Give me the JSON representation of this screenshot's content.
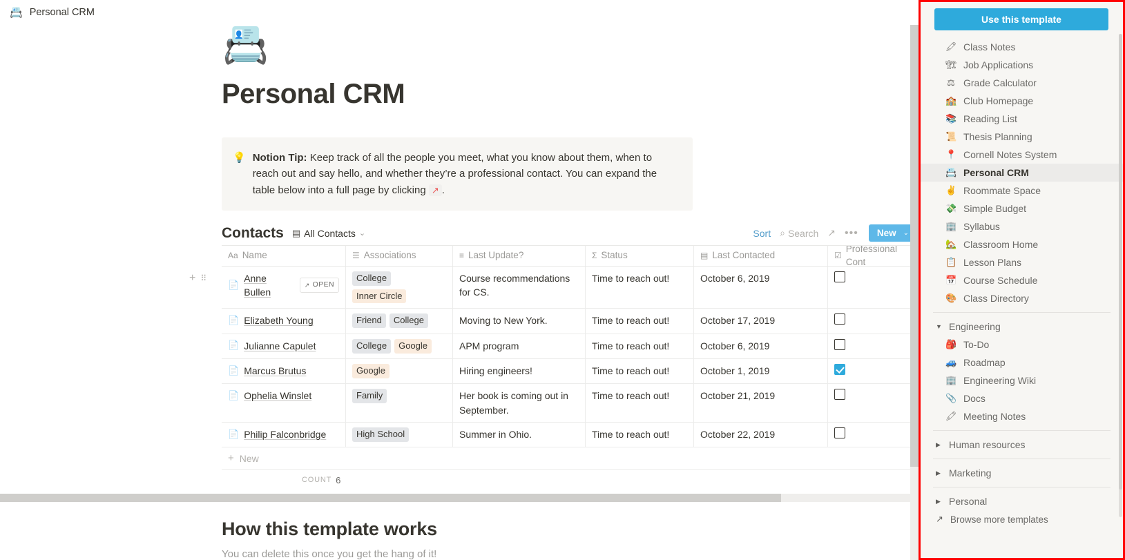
{
  "topbar": {
    "icon": "📇",
    "title": "Personal CRM"
  },
  "page": {
    "icon": "📇",
    "title": "Personal CRM",
    "callout": {
      "icon": "💡",
      "lead": "Notion Tip:",
      "text": " Keep track of all the people you meet, what you know about them, when to reach out and say hello, and whether they’re a professional contact. You can expand the table below into a full page by clicking ",
      "code": "↗",
      "tail": "."
    }
  },
  "database": {
    "title": "Contacts",
    "view_name": "All Contacts",
    "view_icon": "▤",
    "chevron": "⌄",
    "tools": {
      "sort": "Sort",
      "search": "Search",
      "search_icon": "⌕",
      "expand_icon": "↗",
      "more_icon": "•••",
      "new_label": "New",
      "new_chevron": "⌄"
    },
    "columns": [
      {
        "label": "Name",
        "icon": "Aa"
      },
      {
        "label": "Associations",
        "icon": "☰"
      },
      {
        "label": "Last Update?",
        "icon": "≡"
      },
      {
        "label": "Status",
        "icon": "Σ"
      },
      {
        "label": "Last Contacted",
        "icon": "▤"
      },
      {
        "label": "Professional Cont",
        "icon": "☑"
      }
    ],
    "rows": [
      {
        "name": "Anne Bullen",
        "open_label": "OPEN",
        "open_icon": "↗",
        "tags": [
          {
            "text": "College",
            "style": "gray"
          },
          {
            "text": "Inner Circle",
            "style": "orange"
          }
        ],
        "last_update": "Course recommendations for CS.",
        "status": "Time to reach out!",
        "last_contacted": "October 6, 2019",
        "professional": false
      },
      {
        "name": "Elizabeth Young",
        "tags": [
          {
            "text": "Friend",
            "style": "gray"
          },
          {
            "text": "College",
            "style": "gray"
          }
        ],
        "last_update": "Moving to New York.",
        "status": "Time to reach out!",
        "last_contacted": "October 17, 2019",
        "professional": false
      },
      {
        "name": "Julianne Capulet",
        "tags": [
          {
            "text": "College",
            "style": "gray"
          },
          {
            "text": "Google",
            "style": "orange"
          }
        ],
        "last_update": "APM program",
        "status": "Time to reach out!",
        "last_contacted": "October 6, 2019",
        "professional": false
      },
      {
        "name": "Marcus Brutus",
        "tags": [
          {
            "text": "Google",
            "style": "orange"
          }
        ],
        "last_update": "Hiring engineers!",
        "status": "Time to reach out!",
        "last_contacted": "October 1, 2019",
        "professional": true
      },
      {
        "name": "Ophelia Winslet",
        "tags": [
          {
            "text": "Family",
            "style": "gray"
          }
        ],
        "last_update": "Her book is coming out in September.",
        "status": "Time to reach out!",
        "last_contacted": "October 21, 2019",
        "professional": false
      },
      {
        "name": "Philip Falconbridge",
        "tags": [
          {
            "text": "High School",
            "style": "gray"
          }
        ],
        "last_update": "Summer in Ohio.",
        "status": "Time to reach out!",
        "last_contacted": "October 22, 2019",
        "professional": false
      }
    ],
    "new_row_label": "New",
    "new_row_icon": "+",
    "count_label": "COUNT",
    "count_value": "6",
    "row_handle_plus": "+",
    "row_handle_drag": "⠿"
  },
  "bottom": {
    "heading": "How this template works",
    "subtext": "You can delete this once you get the hang of it!"
  },
  "right_panel": {
    "use_template_label": "Use this template",
    "templates": [
      {
        "icon": "🖍",
        "label": "Class Notes",
        "active": false
      },
      {
        "icon": "🏗",
        "label": "Job Applications",
        "active": false
      },
      {
        "icon": "⚖",
        "label": "Grade Calculator",
        "active": false
      },
      {
        "icon": "🏫",
        "label": "Club Homepage",
        "active": false
      },
      {
        "icon": "📚",
        "label": "Reading List",
        "active": false
      },
      {
        "icon": "📜",
        "label": "Thesis Planning",
        "active": false
      },
      {
        "icon": "📍",
        "label": "Cornell Notes System",
        "active": false
      },
      {
        "icon": "📇",
        "label": "Personal CRM",
        "active": true
      },
      {
        "icon": "✌",
        "label": "Roommate Space",
        "active": false
      },
      {
        "icon": "💸",
        "label": "Simple Budget",
        "active": false
      },
      {
        "icon": "🏢",
        "label": "Syllabus",
        "active": false
      },
      {
        "icon": "🏡",
        "label": "Classroom Home",
        "active": false
      },
      {
        "icon": "📋",
        "label": "Lesson Plans",
        "active": false
      },
      {
        "icon": "📅",
        "label": "Course Schedule",
        "active": false
      },
      {
        "icon": "🎨",
        "label": "Class Directory",
        "active": false
      }
    ],
    "groups": [
      {
        "label": "Engineering",
        "triangle": "▼",
        "expanded": true,
        "items": [
          {
            "icon": "🎒",
            "label": "To-Do"
          },
          {
            "icon": "🚙",
            "label": "Roadmap"
          },
          {
            "icon": "🏢",
            "label": "Engineering Wiki"
          },
          {
            "icon": "📎",
            "label": "Docs"
          },
          {
            "icon": "🖍",
            "label": "Meeting Notes"
          }
        ]
      },
      {
        "label": "Human resources",
        "triangle": "▶",
        "expanded": false,
        "items": []
      },
      {
        "label": "Marketing",
        "triangle": "▶",
        "expanded": false,
        "items": []
      },
      {
        "label": "Personal",
        "triangle": "▶",
        "expanded": false,
        "items": []
      }
    ],
    "browse": {
      "icon": "↗",
      "label": "Browse more templates"
    }
  },
  "colors": {
    "accent": "#2eaadc",
    "new_button": "#5eb8e8",
    "panel_bg": "#f7f6f3",
    "highlight_border": "#ff0000",
    "text": "#37352f",
    "muted": "#9b9a97"
  }
}
